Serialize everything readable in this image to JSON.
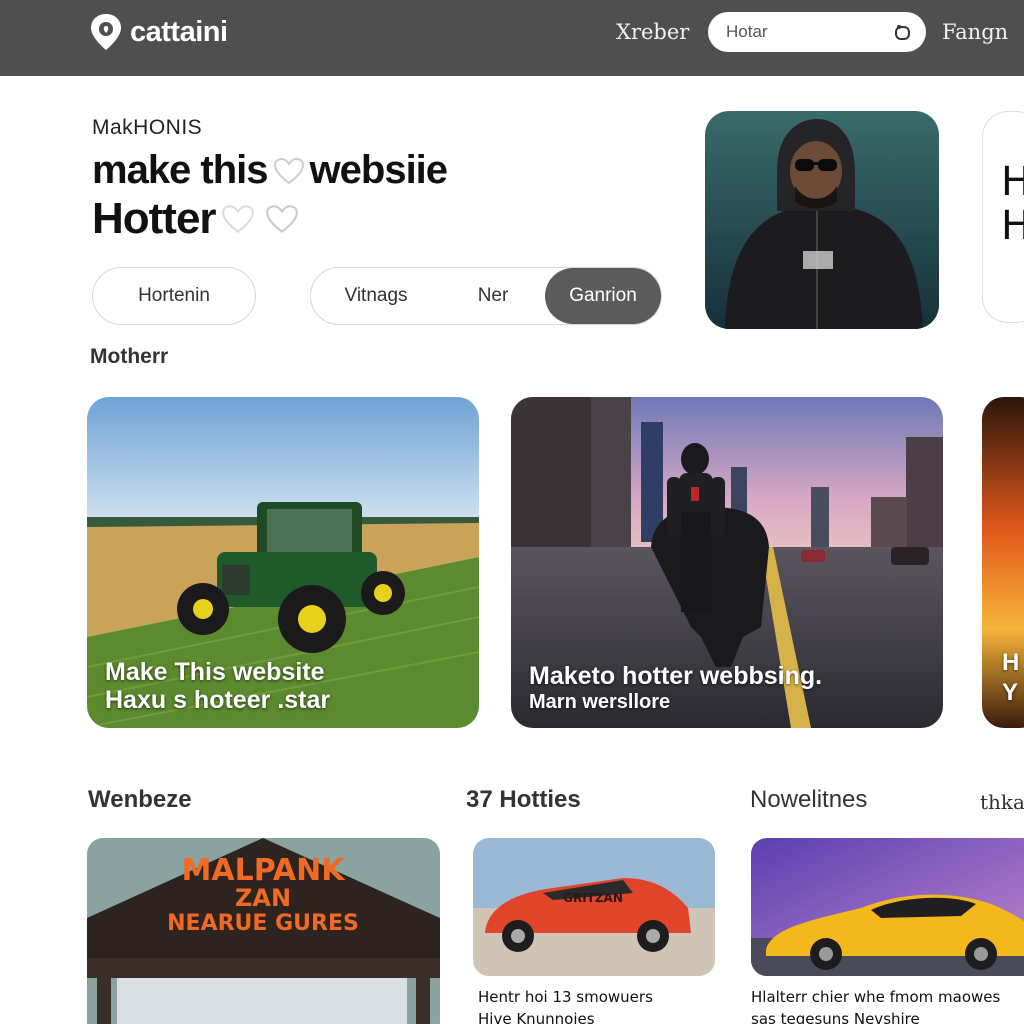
{
  "header": {
    "logo_text": "cattaini",
    "nav_left": "Xreber",
    "search_value": "Hotar",
    "nav_right": "Fangn"
  },
  "hero": {
    "eyebrow": "MakHONIS",
    "line1": "make this",
    "line1_end": "websiie",
    "line2": "Hotter",
    "pill_left": "Hortenin",
    "seg_items": [
      "Vitnags",
      "Ner",
      "Ganrion"
    ],
    "side_card_text": "H H"
  },
  "section_title": "Motherr",
  "cards": [
    {
      "caption_line1": "Make This  website",
      "caption_line2": "Haxu s hoteer .star"
    },
    {
      "caption_line1": "Maketo  hotter webbsing.",
      "caption_line2": "Marn wersllore"
    },
    {
      "caption_line1": "H",
      "caption_line2": "Y"
    }
  ],
  "row_labels": [
    "Wenbeze",
    "37 Hotties",
    "Nowelitnes",
    "thka"
  ],
  "small_cards": [
    {
      "sign_line1": "MALPANK",
      "sign_line2": "ZAN",
      "sign_line3": "NEARUE GURES"
    },
    {
      "caption_line1": "Hentr hoi 13 smowuers",
      "caption_line2": "Hive Knunnoies",
      "car_text": "GRITZAN"
    },
    {
      "caption_line1": "Hlalterr chier whe fmom maowes",
      "caption_line2": "sas tegesuns Nevshire"
    }
  ],
  "colors": {
    "header_bg": "#4f4f4f",
    "segment_active": "#5b5b5b",
    "text_dark": "#111111"
  }
}
